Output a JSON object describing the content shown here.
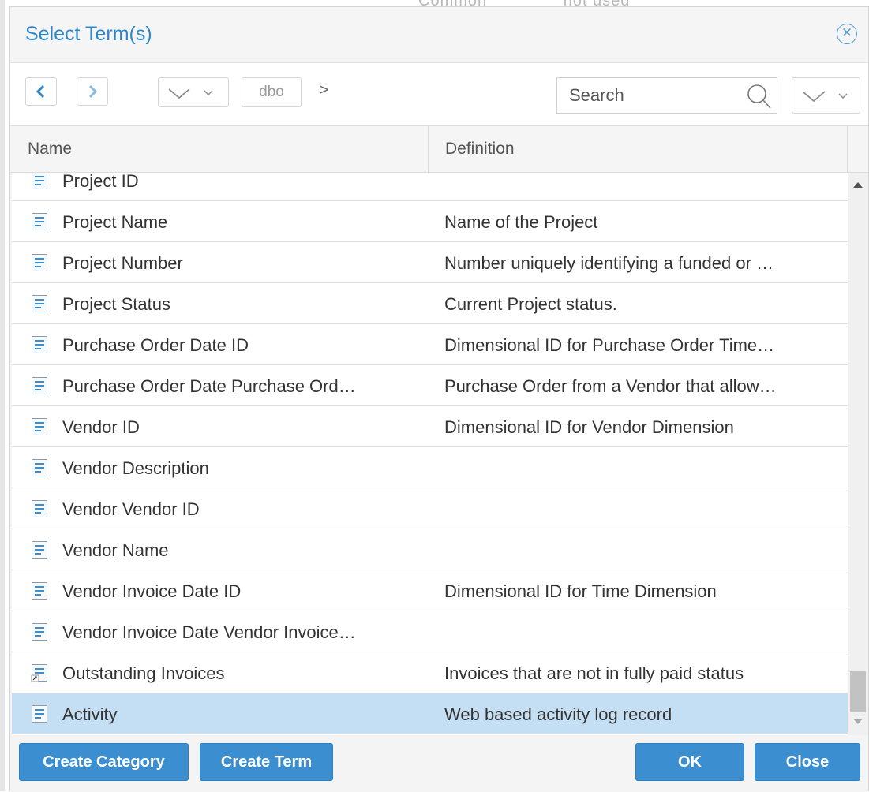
{
  "background": {
    "text_left": "Common",
    "text_right": "not used"
  },
  "dialog": {
    "title": "Select Term(s)",
    "close_icon": "circle-x-icon"
  },
  "toolbar": {
    "back_icon": "chevron-left-icon",
    "forward_icon": "chevron-right-icon",
    "breadcrumb_label": "dbo",
    "breadcrumb_separator": ">",
    "search_placeholder": "Search",
    "search_value": ""
  },
  "table": {
    "columns": [
      "Name",
      "Definition"
    ],
    "rows": [
      {
        "name": "Project ID",
        "definition": "",
        "icon": "term-icon"
      },
      {
        "name": "Project Name",
        "definition": "Name of the Project",
        "icon": "term-icon"
      },
      {
        "name": "Project Number",
        "definition": "Number uniquely identifying a funded or …",
        "icon": "term-icon"
      },
      {
        "name": "Project Status",
        "definition": "Current Project status.",
        "icon": "term-icon"
      },
      {
        "name": "Purchase Order Date ID",
        "definition": "Dimensional ID for Purchase Order Time…",
        "icon": "term-icon"
      },
      {
        "name": "Purchase Order Date Purchase Ord…",
        "definition": "Purchase Order from a Vendor that allow…",
        "icon": "term-icon"
      },
      {
        "name": "Vendor ID",
        "definition": "Dimensional ID for Vendor Dimension",
        "icon": "term-icon"
      },
      {
        "name": "Vendor Description",
        "definition": "",
        "icon": "term-icon"
      },
      {
        "name": "Vendor Vendor ID",
        "definition": "",
        "icon": "term-icon"
      },
      {
        "name": "Vendor Name",
        "definition": "",
        "icon": "term-icon"
      },
      {
        "name": "Vendor Invoice Date ID",
        "definition": "Dimensional ID for Time Dimension",
        "icon": "term-icon"
      },
      {
        "name": "Vendor Invoice Date Vendor Invoice…",
        "definition": "",
        "icon": "term-icon"
      },
      {
        "name": "Outstanding Invoices",
        "definition": "Invoices that are not in fully paid status",
        "icon": "term-shortcut-icon"
      },
      {
        "name": "Activity",
        "definition": "Web based activity log record",
        "icon": "term-icon",
        "selected": true
      }
    ]
  },
  "footer": {
    "create_category": "Create Category",
    "create_term": "Create Term",
    "ok": "OK",
    "close": "Close"
  },
  "colors": {
    "accent": "#2e87c8",
    "button": "#3b8fd0",
    "selected_row": "#c4dff3"
  }
}
